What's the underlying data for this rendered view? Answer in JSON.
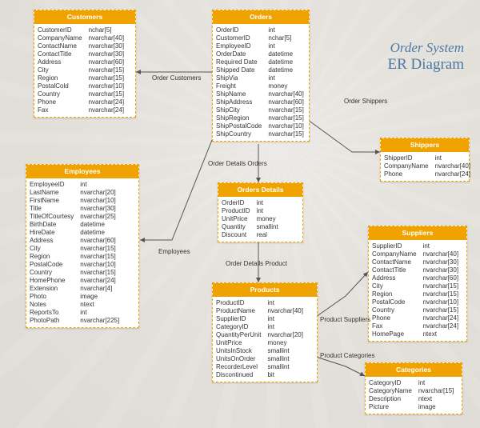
{
  "diagram_title": {
    "line1": "Order System",
    "line2": "ER Diagram"
  },
  "entities": {
    "customers": {
      "name": "Customers",
      "fields": [
        [
          "CustomerID",
          "nchar[5]"
        ],
        [
          "CompanyName",
          "nvarchar[40]"
        ],
        [
          "ContactName",
          "nvarchar[30]"
        ],
        [
          "ContactTitle",
          "nvarchar[30]"
        ],
        [
          "Address",
          "nvarchar[60]"
        ],
        [
          "City",
          "nvarchar[15]"
        ],
        [
          "Region",
          "nvarchar[15]"
        ],
        [
          "PostalCold",
          "nvarchar[10]"
        ],
        [
          "Country",
          "nvarchar[15]"
        ],
        [
          "Phone",
          "nvarchar[24]"
        ],
        [
          "Fax",
          "nvarchar[24]"
        ]
      ]
    },
    "orders": {
      "name": "Orders",
      "fields": [
        [
          "OrderID",
          "int"
        ],
        [
          "CustomerID",
          "nchar[5]"
        ],
        [
          "EmployeeID",
          "int"
        ],
        [
          "OrderDate",
          "datetime"
        ],
        [
          "Required Date",
          "datetime"
        ],
        [
          "Shipped Date",
          "datetime"
        ],
        [
          "ShipVia",
          "int"
        ],
        [
          "Freight",
          "money"
        ],
        [
          "ShipName",
          "nvarchar[40]"
        ],
        [
          "ShipAddress",
          "nvarchar[60]"
        ],
        [
          "ShipCity",
          "nvarchar[15]"
        ],
        [
          "ShipRegion",
          "nvarchar[15]"
        ],
        [
          "ShipPostalCode",
          "nvarchar[10]"
        ],
        [
          "ShipCountry",
          "nvarchar[15]"
        ]
      ]
    },
    "employees": {
      "name": "Employees",
      "fields": [
        [
          "EmployeeID",
          "int"
        ],
        [
          "LastName",
          "nvarchar[20]"
        ],
        [
          "FirstName",
          "nvarchar[10]"
        ],
        [
          "Title",
          "nvarchar[30]"
        ],
        [
          "TitleOfCourtesy",
          "nvarchar[25]"
        ],
        [
          "BirthDate",
          "datetime"
        ],
        [
          "HireDate",
          "datetime"
        ],
        [
          "Address",
          "nvarchar[60]"
        ],
        [
          "City",
          "nvarchar[15]"
        ],
        [
          "Region",
          "nvarchar[15]"
        ],
        [
          "PostalCode",
          "nvarchar[10]"
        ],
        [
          "Country",
          "nvarchar[15]"
        ],
        [
          "HomePhone",
          "nvarchar[24]"
        ],
        [
          "Extension",
          "nvarchar[4]"
        ],
        [
          "Photo",
          "image"
        ],
        [
          "Notes",
          "ntext"
        ],
        [
          "ReportsTo",
          "int"
        ],
        [
          "PhotoPath",
          "nvarchar[225]"
        ]
      ]
    },
    "shippers": {
      "name": "Shippers",
      "fields": [
        [
          "ShipperID",
          "int"
        ],
        [
          "CompanyName",
          "nvarchar[40]"
        ],
        [
          "Phone",
          "nvarchar[24]"
        ]
      ]
    },
    "orders_details": {
      "name": "Orders Details",
      "fields": [
        [
          "OrderID",
          "int"
        ],
        [
          "ProductID",
          "int"
        ],
        [
          "UnitPrice",
          "money"
        ],
        [
          "Quantity",
          "smallint"
        ],
        [
          "Discount",
          "real"
        ]
      ]
    },
    "products": {
      "name": "Products",
      "fields": [
        [
          "ProductID",
          "int"
        ],
        [
          "ProductName",
          "nvarchar[40]"
        ],
        [
          "SupplierID",
          "int"
        ],
        [
          "CategoryID",
          "int"
        ],
        [
          "QuantityPerUnit",
          "nvarchar[20]"
        ],
        [
          "UnitPrice",
          "money"
        ],
        [
          "UnitsInStock",
          "smallint"
        ],
        [
          "UnitsOnOrder",
          "smallint"
        ],
        [
          "RecorderLevel",
          "smallint"
        ],
        [
          "Discontinued",
          "bit"
        ]
      ]
    },
    "suppliers": {
      "name": "Suppliers",
      "fields": [
        [
          "SupplierID",
          "int"
        ],
        [
          "CompanyName",
          "nvarchar[40]"
        ],
        [
          "ContactName",
          "nvarchar[30]"
        ],
        [
          "ContactTitle",
          "nvarchar[30]"
        ],
        [
          "Address",
          "nvarchar[60]"
        ],
        [
          "City",
          "nvarchar[15]"
        ],
        [
          "Region",
          "nvarchar[15]"
        ],
        [
          "PostalCode",
          "nvarchar[10]"
        ],
        [
          "Country",
          "nvarchar[15]"
        ],
        [
          "Phone",
          "nvarchar[24]"
        ],
        [
          "Fax",
          "nvarchar[24]"
        ],
        [
          "HomePage",
          "ntext"
        ]
      ]
    },
    "categories": {
      "name": "Categories",
      "fields": [
        [
          "CategoryID",
          "int"
        ],
        [
          "CategoryName",
          "nvarchar[15]"
        ],
        [
          "Description",
          "ntext"
        ],
        [
          "Picture",
          "image"
        ]
      ]
    }
  },
  "relationships": {
    "order_customers": "Order Customers",
    "order_details_orders": "Order Details Orders",
    "employees": "Employees",
    "order_shippers": "Order Shippers",
    "order_details_product": "Order Details Product",
    "product_suppliers": "Product Suppliers",
    "product_categories": "Product Categories"
  }
}
